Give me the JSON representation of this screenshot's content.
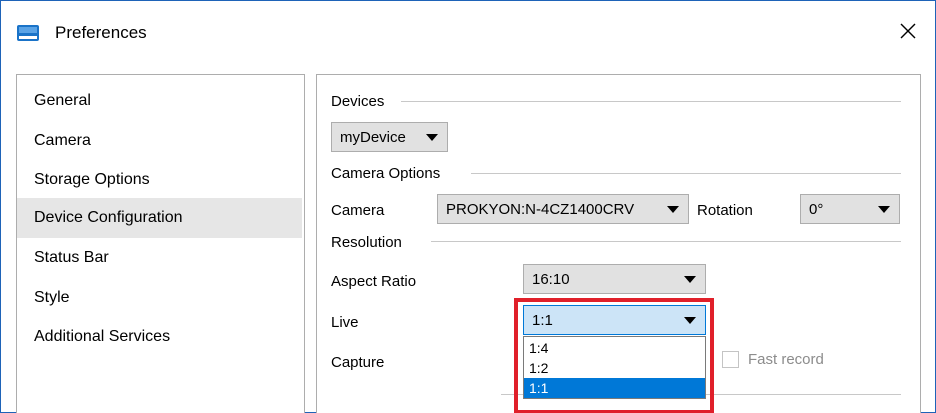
{
  "window": {
    "title": "Preferences",
    "icon": "window-app-icon",
    "close_icon": "close-icon"
  },
  "sidebar": {
    "items": [
      {
        "label": "General",
        "selected": false
      },
      {
        "label": "Camera",
        "selected": false
      },
      {
        "label": "Storage Options",
        "selected": false
      },
      {
        "label": "Device Configuration",
        "selected": true
      },
      {
        "label": "Status Bar",
        "selected": false
      },
      {
        "label": "Style",
        "selected": false
      },
      {
        "label": "Additional Services",
        "selected": false
      }
    ]
  },
  "devices": {
    "group_label": "Devices",
    "device_value": "myDevice"
  },
  "camera_options": {
    "group_label": "Camera Options",
    "camera_label": "Camera",
    "camera_value": "PROKYON:N-4CZ1400CRV",
    "rotation_label": "Rotation",
    "rotation_value": "0°"
  },
  "resolution": {
    "group_label": "Resolution",
    "aspect_ratio_label": "Aspect Ratio",
    "aspect_ratio_value": "16:10",
    "live_label": "Live",
    "live_value": "1:1",
    "live_options": [
      "1:4",
      "1:2",
      "1:1"
    ],
    "live_selected_option": "1:1",
    "capture_label": "Capture",
    "fast_record_label": "Fast record",
    "fast_record_checked": false
  },
  "colors": {
    "selection_blue": "#0078d7",
    "highlight_red": "#e0202a",
    "nav_selected_bg": "#e6e6e6"
  }
}
